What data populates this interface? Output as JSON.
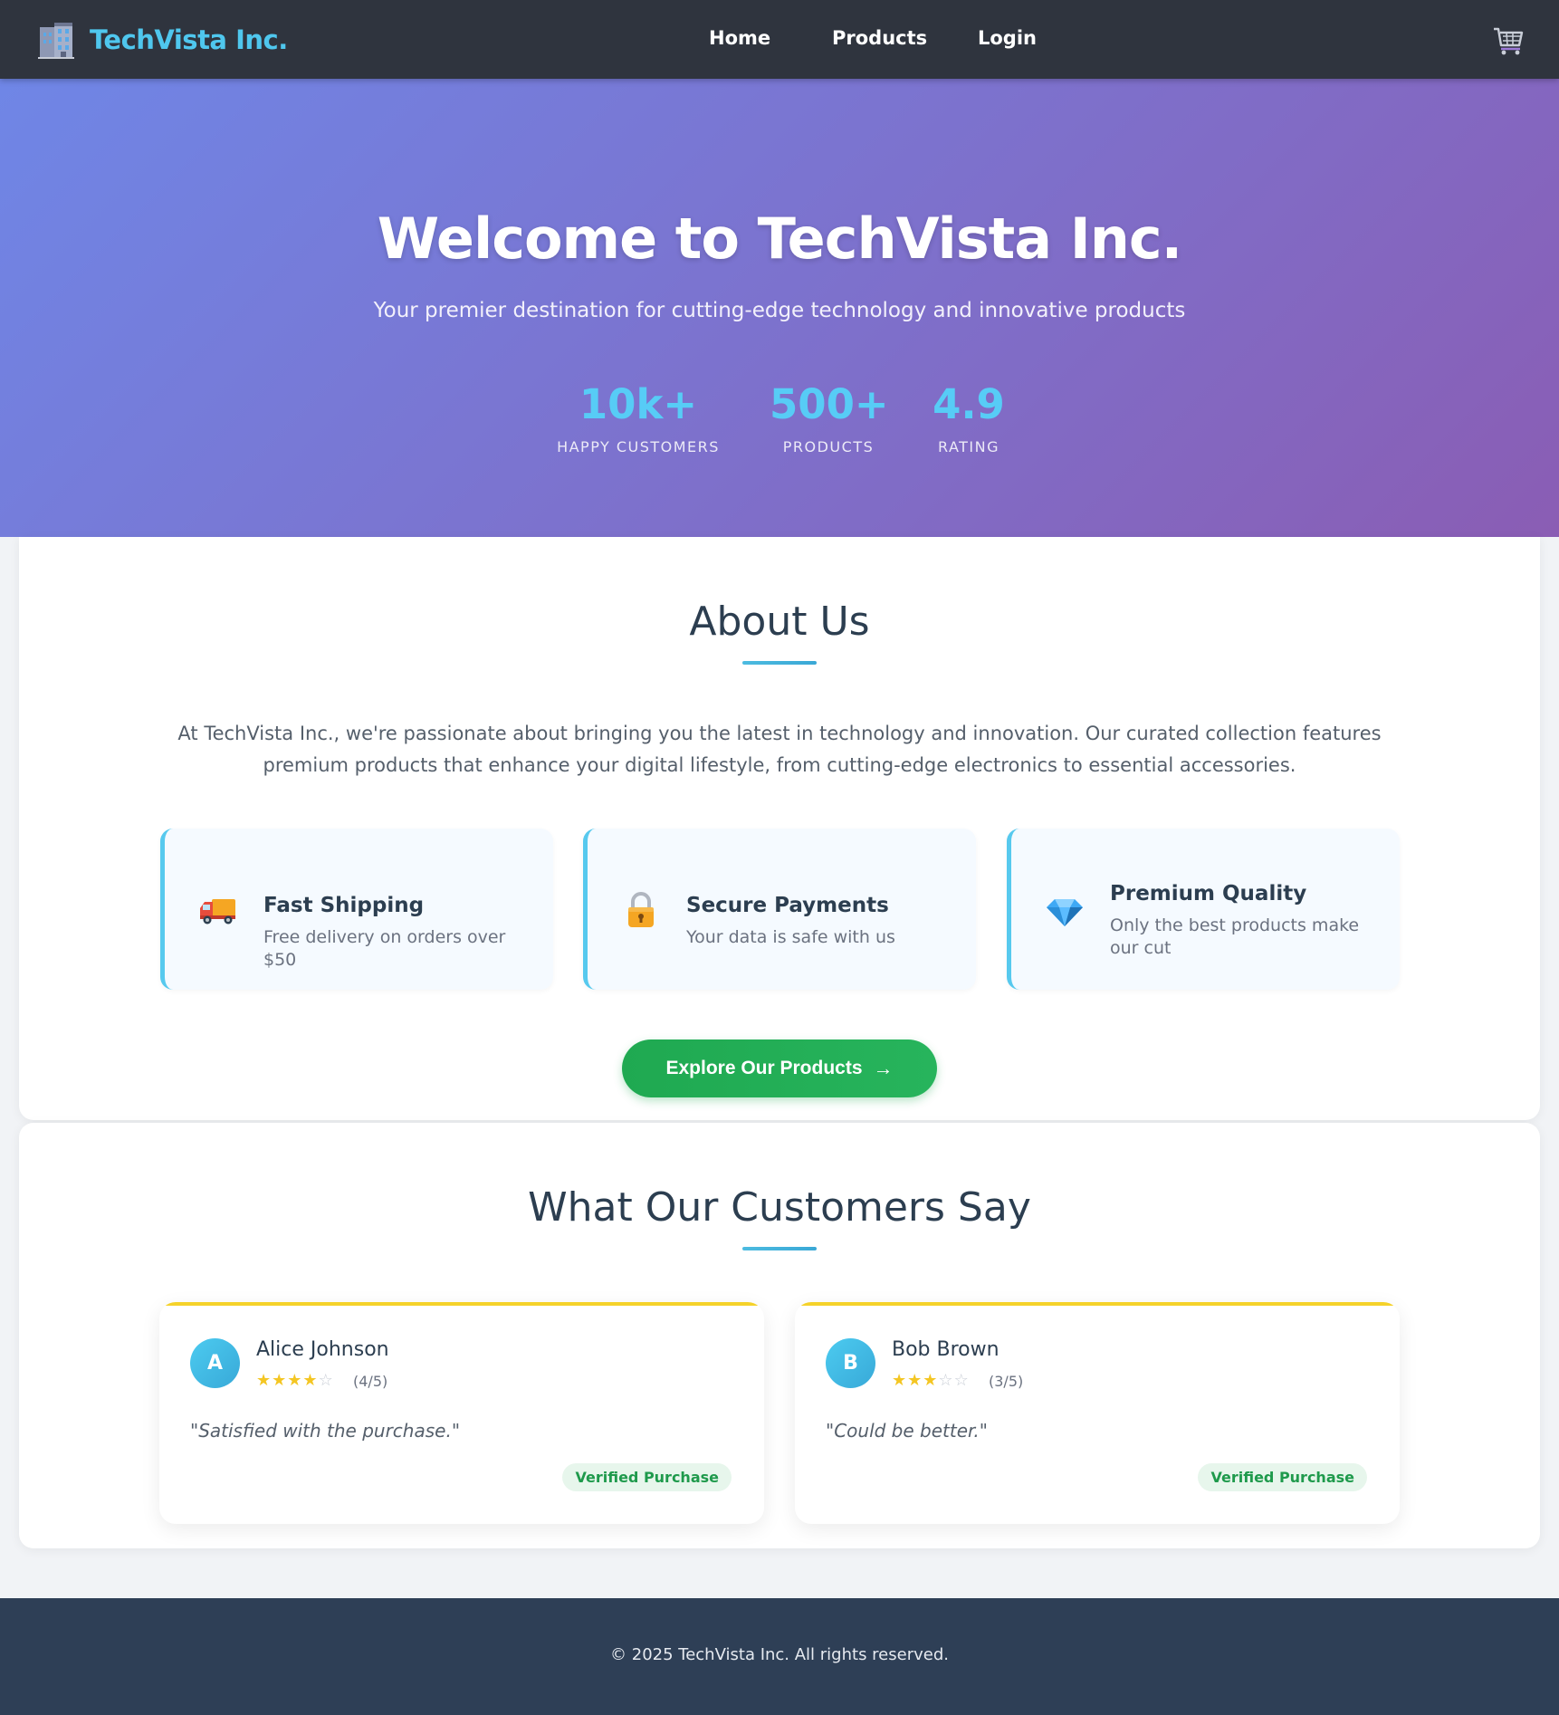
{
  "nav": {
    "brand_name": "TechVista Inc.",
    "brand_icon": "building-icon",
    "links": [
      "Home",
      "Products",
      "Login"
    ],
    "cart_icon": "shopping-cart-icon"
  },
  "hero": {
    "title": "Welcome to TechVista Inc.",
    "subtitle": "Your premier destination for cutting-edge technology and innovative products",
    "stats": [
      {
        "value": "10k+",
        "label": "HAPPY CUSTOMERS"
      },
      {
        "value": "500+",
        "label": "PRODUCTS"
      },
      {
        "value": "4.9",
        "label": "RATING"
      }
    ]
  },
  "about": {
    "title": "About Us",
    "text": "At TechVista Inc., we're passionate about bringing you the latest in technology and innovation. Our curated collection features premium products that enhance your digital lifestyle, from cutting-edge electronics to essential accessories.",
    "features": [
      {
        "icon": "delivery-truck-icon",
        "title": "Fast Shipping",
        "desc": "Free delivery on orders over $50"
      },
      {
        "icon": "padlock-icon",
        "title": "Secure Payments",
        "desc": "Your data is safe with us"
      },
      {
        "icon": "diamond-icon",
        "title": "Premium Quality",
        "desc": "Only the best products make our cut"
      }
    ],
    "cta_label": "Explore Our Products",
    "cta_arrow": "→"
  },
  "reviews": {
    "title": "What Our Customers Say",
    "items": [
      {
        "initial": "A",
        "name": "Alice Johnson",
        "rating": 4,
        "rating_text": "(4/5)",
        "quote": "\"Satisfied with the purchase.\"",
        "badge": "Verified Purchase"
      },
      {
        "initial": "B",
        "name": "Bob Brown",
        "rating": 3,
        "rating_text": "(3/5)",
        "quote": "\"Could be better.\"",
        "badge": "Verified Purchase"
      }
    ]
  },
  "footer": {
    "text": "© 2025 TechVista Inc. All rights reserved."
  },
  "colors": {
    "nav_bg": "#2f343e",
    "brand": "#4fc7ee",
    "hero_start": "#6f86e6",
    "hero_end": "#8a5db4",
    "stat": "#57ccf6",
    "accent": "#57c9ee",
    "cta": "#1fa951",
    "star": "#f4c623",
    "footer_bg": "#2e3f56"
  }
}
